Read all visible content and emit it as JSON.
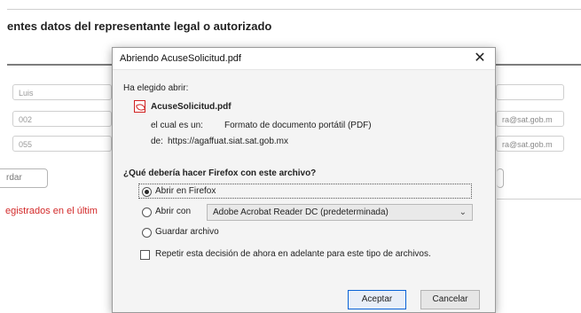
{
  "page": {
    "heading": "entes datos del representante legal o autorizado",
    "fields": {
      "name": "Luis",
      "phone1": "002",
      "phone2": "055",
      "email1": "ra@sat.gob.m",
      "email2": "ra@sat.gob.m"
    },
    "save_button": "rdar",
    "error_text": "egistrados en el últim"
  },
  "dialog": {
    "title": "Abriendo AcuseSolicitud.pdf",
    "chosen_open_label": "Ha elegido abrir:",
    "file_name": "AcuseSolicitud.pdf",
    "type_label": "el cual es un:",
    "type_value": "Formato de documento portátil (PDF)",
    "from_label": "de:",
    "from_value": "https://agaffuat.siat.sat.gob.mx",
    "question": "¿Qué debería hacer Firefox con este archivo?",
    "options": {
      "open_in_firefox": "Abrir en Firefox",
      "open_with": "Abrir con",
      "save_file": "Guardar archivo"
    },
    "open_with_app": "Adobe Acrobat Reader DC (predeterminada)",
    "remember_decision": "Repetir esta decisión de ahora en adelante para este tipo de archivos.",
    "buttons": {
      "accept": "Aceptar",
      "cancel": "Cancelar"
    },
    "selected_option": "open_in_firefox"
  },
  "colors": {
    "error_red": "#d32a2a",
    "focus_blue": "#0a63d7"
  }
}
